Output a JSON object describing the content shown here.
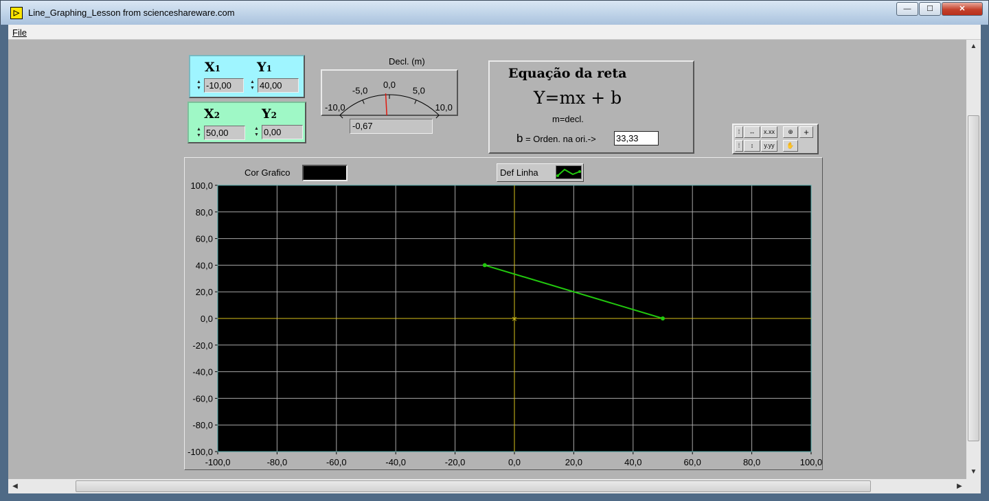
{
  "window": {
    "title": "Line_Graphing_Lesson from scienceshareware.com",
    "minimize_label": "—",
    "maximize_label": "☐",
    "close_label": "✕"
  },
  "menu": {
    "file_label": "File"
  },
  "inputs": {
    "x1": {
      "label": "X",
      "sub": "1",
      "value": "-10,00"
    },
    "y1": {
      "label": "Y",
      "sub": "1",
      "value": "40,00"
    },
    "x2": {
      "label": "X",
      "sub": "2",
      "value": "50,00"
    },
    "y2": {
      "label": "Y",
      "sub": "2",
      "value": "0,00"
    }
  },
  "gauge": {
    "label": "Decl. (m)",
    "ticks": [
      "-10,0",
      "-5,0",
      "0,0",
      "5,0",
      "10,0"
    ],
    "min": -10,
    "max": 10,
    "value": -0.67,
    "readout": "-0,67",
    "needle_color": "#e0190f"
  },
  "equation": {
    "title": "Equação da reta",
    "formula": "Y=mx + b",
    "subtitle": "m=decl.",
    "b_prefix": "b",
    "b_label": " = Orden. na ori.->",
    "b_value": "33,33"
  },
  "palette": {
    "icons": [
      "grip-icon",
      "x-scale-icon",
      "x-format-icon",
      "zoom-icon",
      "cursor-icon",
      "grip-icon",
      "y-scale-icon",
      "y-format-icon",
      "pan-hand-icon"
    ]
  },
  "graph_controls": {
    "cor_label": "Cor Grafico",
    "cor_color": "#000000",
    "def_label": "Def Linha",
    "line_color": "#22c80e"
  },
  "chart_data": {
    "type": "line",
    "title": "",
    "xlabel": "",
    "ylabel": "",
    "xlim": [
      -100,
      100
    ],
    "ylim": [
      -100,
      100
    ],
    "x_ticks": [
      "-100,0",
      "-80,0",
      "-60,0",
      "-40,0",
      "-20,0",
      "0,0",
      "20,0",
      "40,0",
      "60,0",
      "80,0",
      "100,0"
    ],
    "y_ticks": [
      "100,0",
      "80,0",
      "60,0",
      "40,0",
      "20,0",
      "0,0",
      "-20,0",
      "-40,0",
      "-60,0",
      "-80,0",
      "-100,0"
    ],
    "grid": true,
    "background": "#000000",
    "grid_color": "#a9a9a9",
    "axis_color": "#d7c21a",
    "series": [
      {
        "x": [
          -10,
          50
        ],
        "y": [
          40,
          0
        ],
        "color": "#22c80e"
      }
    ]
  }
}
